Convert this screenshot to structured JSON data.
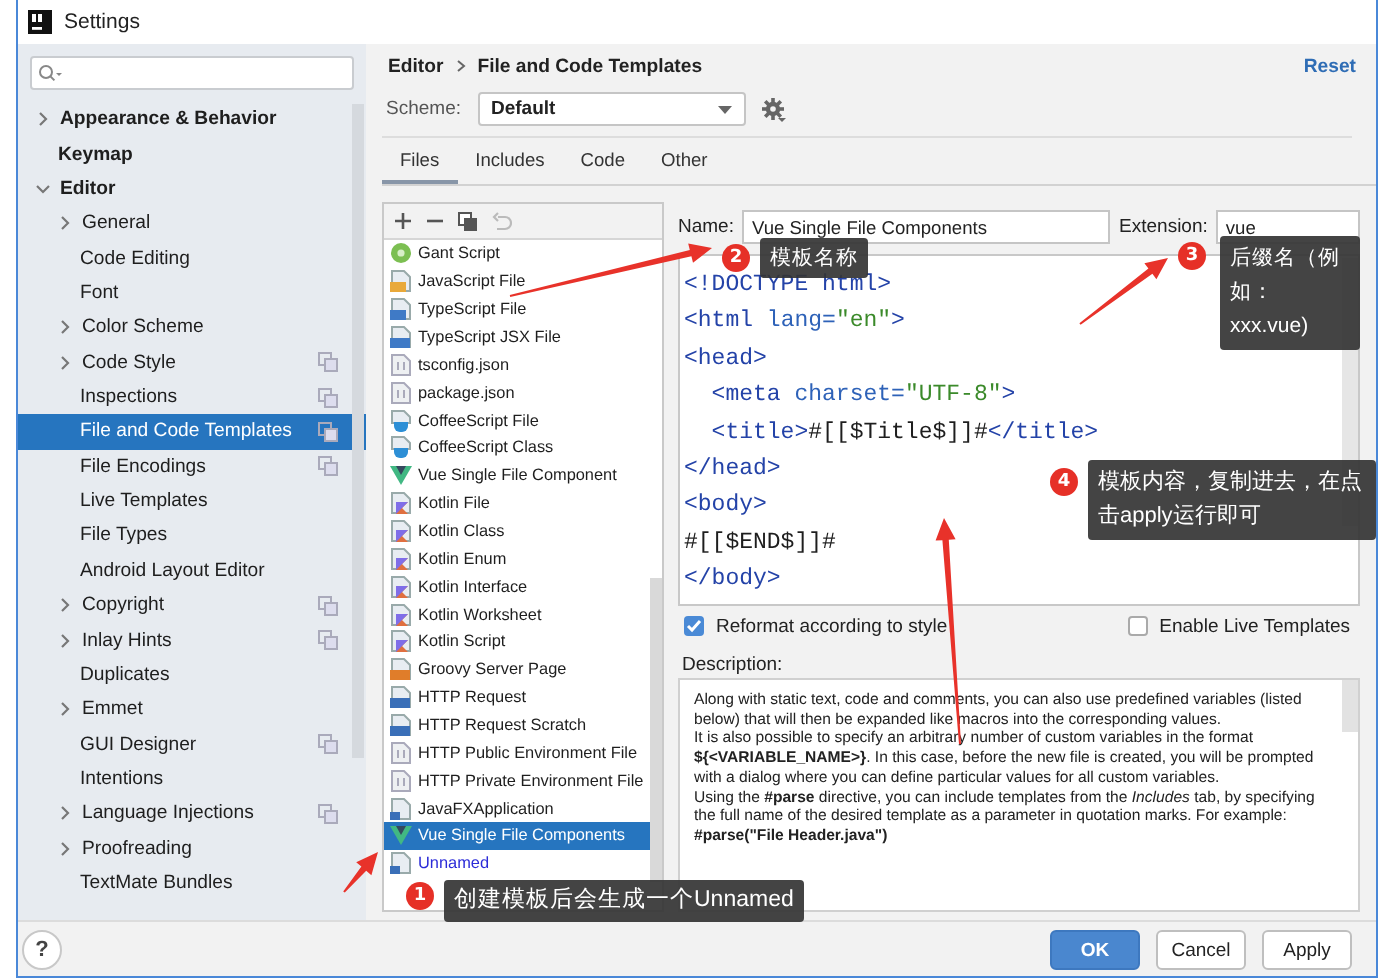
{
  "window": {
    "title": "Settings"
  },
  "sidebar": {
    "items": [
      {
        "label": "Appearance & Behavior",
        "expanded": false,
        "selected": false
      },
      {
        "label": "Keymap",
        "selected": false
      },
      {
        "label": "Editor",
        "expanded": true,
        "selected": false,
        "children": [
          {
            "label": "General",
            "expanded": false,
            "copy_icon": false,
            "selected": false
          },
          {
            "label": "Code Editing",
            "copy_icon": false,
            "selected": false
          },
          {
            "label": "Font",
            "copy_icon": false,
            "selected": false
          },
          {
            "label": "Color Scheme",
            "expanded": false,
            "copy_icon": false,
            "selected": false
          },
          {
            "label": "Code Style",
            "expanded": false,
            "copy_icon": true,
            "selected": false
          },
          {
            "label": "Inspections",
            "copy_icon": true,
            "selected": false
          },
          {
            "label": "File and Code Templates",
            "copy_icon": true,
            "selected": true
          },
          {
            "label": "File Encodings",
            "copy_icon": true,
            "selected": false
          },
          {
            "label": "Live Templates",
            "copy_icon": false,
            "selected": false
          },
          {
            "label": "File Types",
            "copy_icon": false,
            "selected": false
          },
          {
            "label": "Android Layout Editor",
            "copy_icon": false,
            "selected": false
          },
          {
            "label": "Copyright",
            "expanded": false,
            "copy_icon": true,
            "selected": false
          },
          {
            "label": "Inlay Hints",
            "expanded": false,
            "copy_icon": true,
            "selected": false
          },
          {
            "label": "Duplicates",
            "copy_icon": false,
            "selected": false
          },
          {
            "label": "Emmet",
            "expanded": false,
            "copy_icon": false,
            "selected": false
          },
          {
            "label": "GUI Designer",
            "copy_icon": true,
            "selected": false
          },
          {
            "label": "Intentions",
            "copy_icon": false,
            "selected": false
          },
          {
            "label": "Language Injections",
            "expanded": false,
            "copy_icon": true,
            "selected": false
          },
          {
            "label": "Proofreading",
            "expanded": false,
            "copy_icon": false,
            "selected": false
          },
          {
            "label": "TextMate Bundles",
            "copy_icon": false,
            "selected": false
          }
        ]
      }
    ]
  },
  "breadcrumb": [
    "Editor",
    "File and Code Templates"
  ],
  "reset": "Reset",
  "scheme": {
    "label": "Scheme:",
    "value": "Default"
  },
  "tabs": [
    {
      "label": "Files",
      "selected": true
    },
    {
      "label": "Includes",
      "selected": false
    },
    {
      "label": "Code",
      "selected": false
    },
    {
      "label": "Other",
      "selected": false
    }
  ],
  "templates": [
    {
      "label": "Gant Script",
      "kind": "gant",
      "selected": false,
      "new": false
    },
    {
      "label": "JavaScript File",
      "kind": "js",
      "selected": false,
      "new": false
    },
    {
      "label": "TypeScript File",
      "kind": "ts",
      "selected": false,
      "new": false
    },
    {
      "label": "TypeScript JSX File",
      "kind": "tsx",
      "selected": false,
      "new": false
    },
    {
      "label": "tsconfig.json",
      "kind": "json",
      "selected": false,
      "new": false
    },
    {
      "label": "package.json",
      "kind": "json",
      "selected": false,
      "new": false
    },
    {
      "label": "CoffeeScript File",
      "kind": "coffee",
      "selected": false,
      "new": false
    },
    {
      "label": "CoffeeScript Class",
      "kind": "coffee",
      "selected": false,
      "new": false
    },
    {
      "label": "Vue Single File Component",
      "kind": "vue",
      "selected": false,
      "new": false
    },
    {
      "label": "Kotlin File",
      "kind": "kotlin",
      "selected": false,
      "new": false
    },
    {
      "label": "Kotlin Class",
      "kind": "kotlin",
      "selected": false,
      "new": false
    },
    {
      "label": "Kotlin Enum",
      "kind": "kotlin",
      "selected": false,
      "new": false
    },
    {
      "label": "Kotlin Interface",
      "kind": "kotlin",
      "selected": false,
      "new": false
    },
    {
      "label": "Kotlin Worksheet",
      "kind": "kotlin",
      "selected": false,
      "new": false
    },
    {
      "label": "Kotlin Script",
      "kind": "kotlin",
      "selected": false,
      "new": false
    },
    {
      "label": "Groovy Server Page",
      "kind": "gsp",
      "selected": false,
      "new": false
    },
    {
      "label": "HTTP Request",
      "kind": "api",
      "selected": false,
      "new": false
    },
    {
      "label": "HTTP Request Scratch",
      "kind": "api",
      "selected": false,
      "new": false
    },
    {
      "label": "HTTP Public Environment File",
      "kind": "json",
      "selected": false,
      "new": false
    },
    {
      "label": "HTTP Private Environment File",
      "kind": "json",
      "selected": false,
      "new": false
    },
    {
      "label": "JavaFXApplication",
      "kind": "java",
      "selected": false,
      "new": false
    },
    {
      "label": "Vue Single File Components",
      "kind": "vue",
      "selected": true,
      "new": false
    },
    {
      "label": "Unnamed",
      "kind": "java",
      "selected": false,
      "new": true
    }
  ],
  "name": {
    "label": "Name:",
    "value": "Vue Single File Components"
  },
  "extension": {
    "label": "Extension:",
    "value": "vue"
  },
  "code_lines": [
    [
      {
        "text": "<!DOCTYPE html>",
        "kind": "tag"
      }
    ],
    [
      {
        "text": "<html",
        "kind": "tag"
      },
      {
        "text": " lang=",
        "kind": "attr"
      },
      {
        "text": "\"en\"",
        "kind": "str"
      },
      {
        "text": ">",
        "kind": "tag"
      }
    ],
    [
      {
        "text": "<head>",
        "kind": "tag"
      }
    ],
    [
      {
        "text": "  <meta",
        "kind": "tag"
      },
      {
        "text": " charset=",
        "kind": "attr"
      },
      {
        "text": "\"UTF-8\"",
        "kind": "str"
      },
      {
        "text": ">",
        "kind": "tag"
      }
    ],
    [
      {
        "text": "  <title>",
        "kind": "tag"
      },
      {
        "text": "#[[$Title$]]#",
        "kind": "text"
      },
      {
        "text": "</title>",
        "kind": "tag"
      }
    ],
    [
      {
        "text": "</head>",
        "kind": "tag"
      }
    ],
    [
      {
        "text": "<body>",
        "kind": "tag"
      }
    ],
    [
      {
        "text": "#[[$END$]]#",
        "kind": "text"
      }
    ],
    [
      {
        "text": "</body>",
        "kind": "tag"
      }
    ]
  ],
  "options": [
    {
      "label": "Reformat according to style",
      "checked": true
    },
    {
      "label": "Enable Live Templates",
      "checked": false
    }
  ],
  "description": {
    "label": "Description:",
    "paragraphs": [
      {
        "kind": "text",
        "text": "Along with static text, code and comments, you can also use predefined variables (listed below) that will then be expanded like macros into the corresponding values."
      },
      {
        "kind": "text",
        "text": "It is also possible to specify an arbitrary number of custom variables in the format **${<VARIABLE_NAME>}**. In this case, before the new file is created, you will be prompted with a dialog where you can define particular values for all custom variables."
      },
      {
        "kind": "text",
        "text": "Using the **#parse** directive, you can include templates from the *Includes* tab, by specifying the full name of the desired template as a parameter in quotation marks. For example:"
      },
      {
        "kind": "code",
        "text": "#parse(\"File Header.java\")"
      }
    ]
  },
  "help": "?",
  "buttons": [
    {
      "label": "OK",
      "primary": true
    },
    {
      "label": "Cancel",
      "primary": false
    },
    {
      "label": "Apply",
      "primary": false
    }
  ],
  "annotations": [
    {
      "number": "1",
      "text": "创建模板后会生成一个Unnamed"
    },
    {
      "number": "2",
      "text": "模板名称"
    },
    {
      "number": "3",
      "text": "后缀名（例如：xxx.vue)"
    },
    {
      "number": "4",
      "text": "模板内容，复制进去，在点击apply运行即可"
    }
  ]
}
